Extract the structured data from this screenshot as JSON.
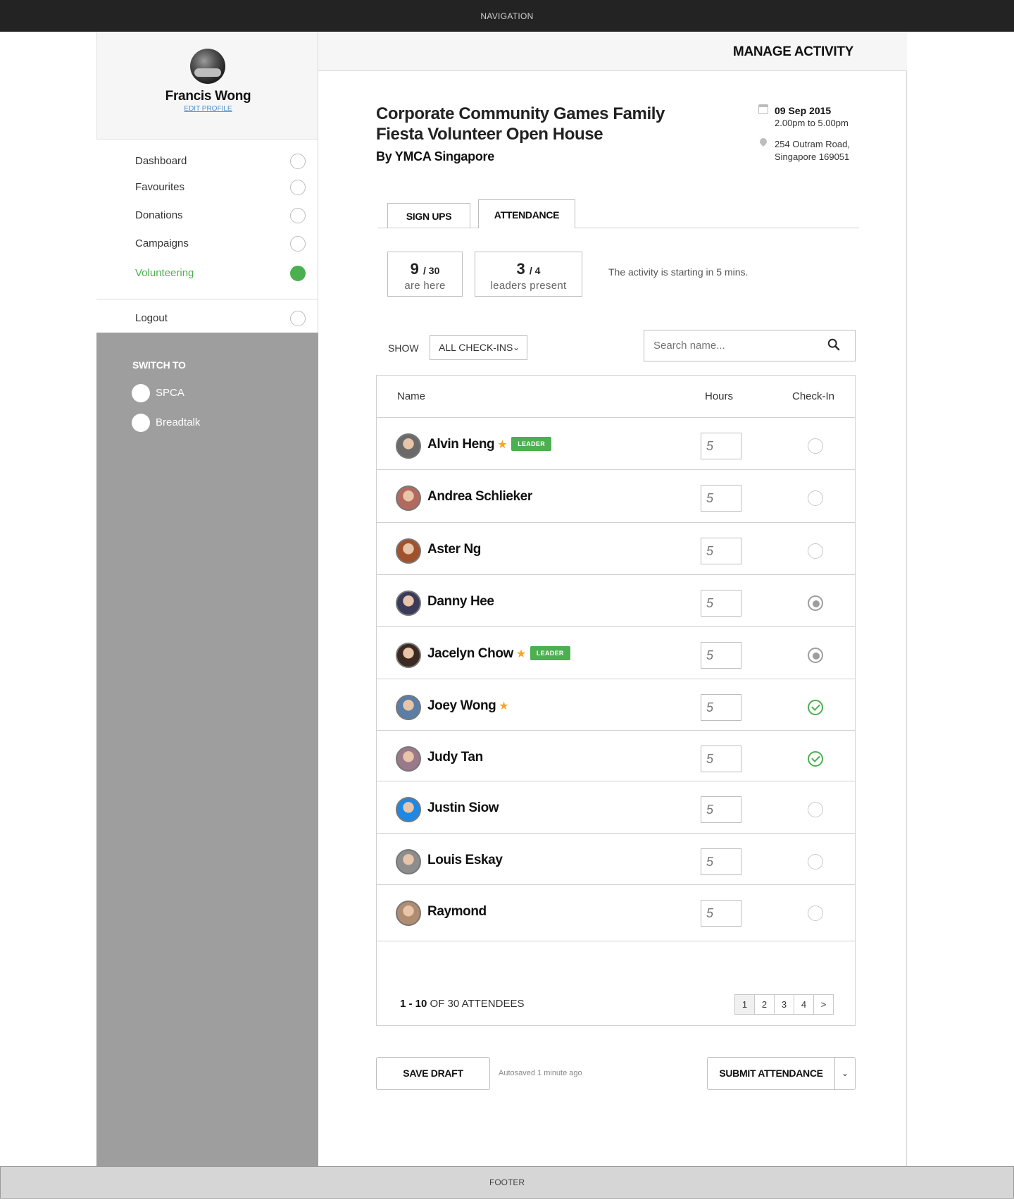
{
  "nav": {
    "label": "NAVIGATION"
  },
  "profile": {
    "name": "Francis Wong",
    "edit_label": "EDIT PROFILE"
  },
  "menu": {
    "items": [
      {
        "label": "Dashboard",
        "active": false
      },
      {
        "label": "Favourites",
        "active": false
      },
      {
        "label": "Donations",
        "active": false
      },
      {
        "label": "Campaigns",
        "active": false
      },
      {
        "label": "Volunteering",
        "active": true
      }
    ],
    "logout_label": "Logout"
  },
  "switch_to": {
    "title": "SWITCH TO",
    "items": [
      {
        "label": "SPCA"
      },
      {
        "label": "Breadtalk"
      }
    ]
  },
  "header": {
    "title": "MANAGE ACTIVITY"
  },
  "activity": {
    "title": "Corporate Community Games Family Fiesta Volunteer Open House",
    "org": "By YMCA Singapore",
    "date": "09 Sep 2015",
    "time": "2.00pm to 5.00pm",
    "address_line1": "254 Outram Road,",
    "address_line2": "Singapore 169051"
  },
  "tabs": {
    "signups": "SIGN UPS",
    "attendance": "ATTENDANCE",
    "active": "attendance"
  },
  "stats": {
    "here_count": "9",
    "here_total": "/ 30",
    "here_label": "are here",
    "leaders_count": "3",
    "leaders_total": "/ 4",
    "leaders_label": "leaders present",
    "starting_text": "The activity is starting in 5 mins."
  },
  "filter": {
    "show_label": "SHOW",
    "selected": "ALL CHECK-INS",
    "search_placeholder": "Search name..."
  },
  "table": {
    "columns": {
      "name": "Name",
      "hours": "Hours",
      "checkin": "Check-In"
    },
    "rows": [
      {
        "name": "Alvin Heng",
        "star": true,
        "leader": true,
        "hours_placeholder": "5",
        "checkin": "none",
        "avatar_color": "#6a6a6a"
      },
      {
        "name": "Andrea Schlieker",
        "star": false,
        "leader": false,
        "hours_placeholder": "5",
        "checkin": "none",
        "avatar_color": "#b36a5e"
      },
      {
        "name": "Aster Ng",
        "star": false,
        "leader": false,
        "hours_placeholder": "5",
        "checkin": "none",
        "avatar_color": "#a0522d"
      },
      {
        "name": "Danny Hee",
        "star": false,
        "leader": false,
        "hours_placeholder": "5",
        "checkin": "partial",
        "avatar_color": "#3a3a5a"
      },
      {
        "name": "Jacelyn Chow",
        "star": true,
        "leader": true,
        "hours_placeholder": "5",
        "checkin": "partial",
        "avatar_color": "#3b2a22"
      },
      {
        "name": "Joey Wong",
        "star": true,
        "leader": false,
        "hours_placeholder": "5",
        "checkin": "done",
        "avatar_color": "#5a7ea6"
      },
      {
        "name": "Judy Tan",
        "star": false,
        "leader": false,
        "hours_placeholder": "5",
        "checkin": "done",
        "avatar_color": "#9a7a8a"
      },
      {
        "name": "Justin Siow",
        "star": false,
        "leader": false,
        "hours_placeholder": "5",
        "checkin": "none",
        "avatar_color": "#1e88e5"
      },
      {
        "name": "Louis Eskay",
        "star": false,
        "leader": false,
        "hours_placeholder": "5",
        "checkin": "none",
        "avatar_color": "#8d8d8d"
      },
      {
        "name": "Raymond",
        "star": false,
        "leader": false,
        "hours_placeholder": "5",
        "checkin": "none",
        "avatar_color": "#b08c70"
      }
    ],
    "leader_badge": "LEADER",
    "range_text": "1 - 10",
    "of_text": "OF",
    "total_text": "30",
    "attendees_text": "ATTENDEES",
    "pages": [
      "1",
      "2",
      "3",
      "4",
      ">"
    ],
    "current_page": "1"
  },
  "actions": {
    "save_draft": "SAVE DRAFT",
    "autosaved": "Autosaved 1 minute ago",
    "submit": "SUBMIT ATTENDANCE",
    "dropdown_icon": "chevron-down-icon"
  },
  "footer": {
    "label": "FOOTER"
  },
  "colors": {
    "accent_green": "#4caf50",
    "star_orange": "#f5a623",
    "sidebar_gray": "#9e9e9e",
    "topbar": "#232323"
  }
}
